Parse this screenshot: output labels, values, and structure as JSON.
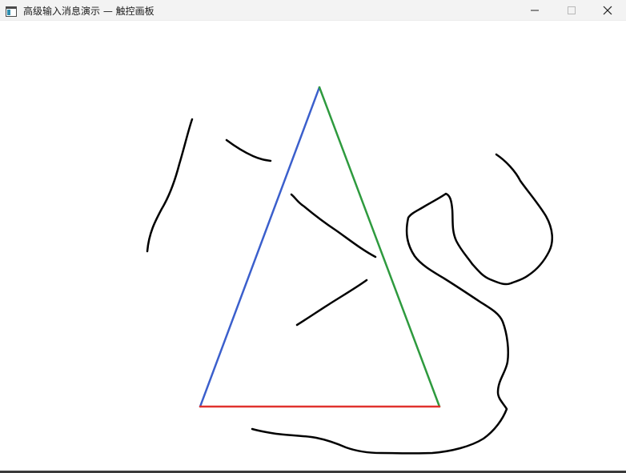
{
  "window": {
    "title": "高级输入消息演示 — 触控画板",
    "icons": {
      "app": "app-window-icon",
      "minimize": "minimize-icon",
      "maximize": "maximize-icon",
      "close": "close-icon"
    }
  },
  "colors": {
    "titlebar_bg": "#f3f3f3",
    "canvas_bg": "#ffffff",
    "triangle_left_side": "#3b5fcc",
    "triangle_right_side": "#2e9a3e",
    "triangle_base": "#e0322e",
    "freehand_stroke": "#000000"
  }
}
